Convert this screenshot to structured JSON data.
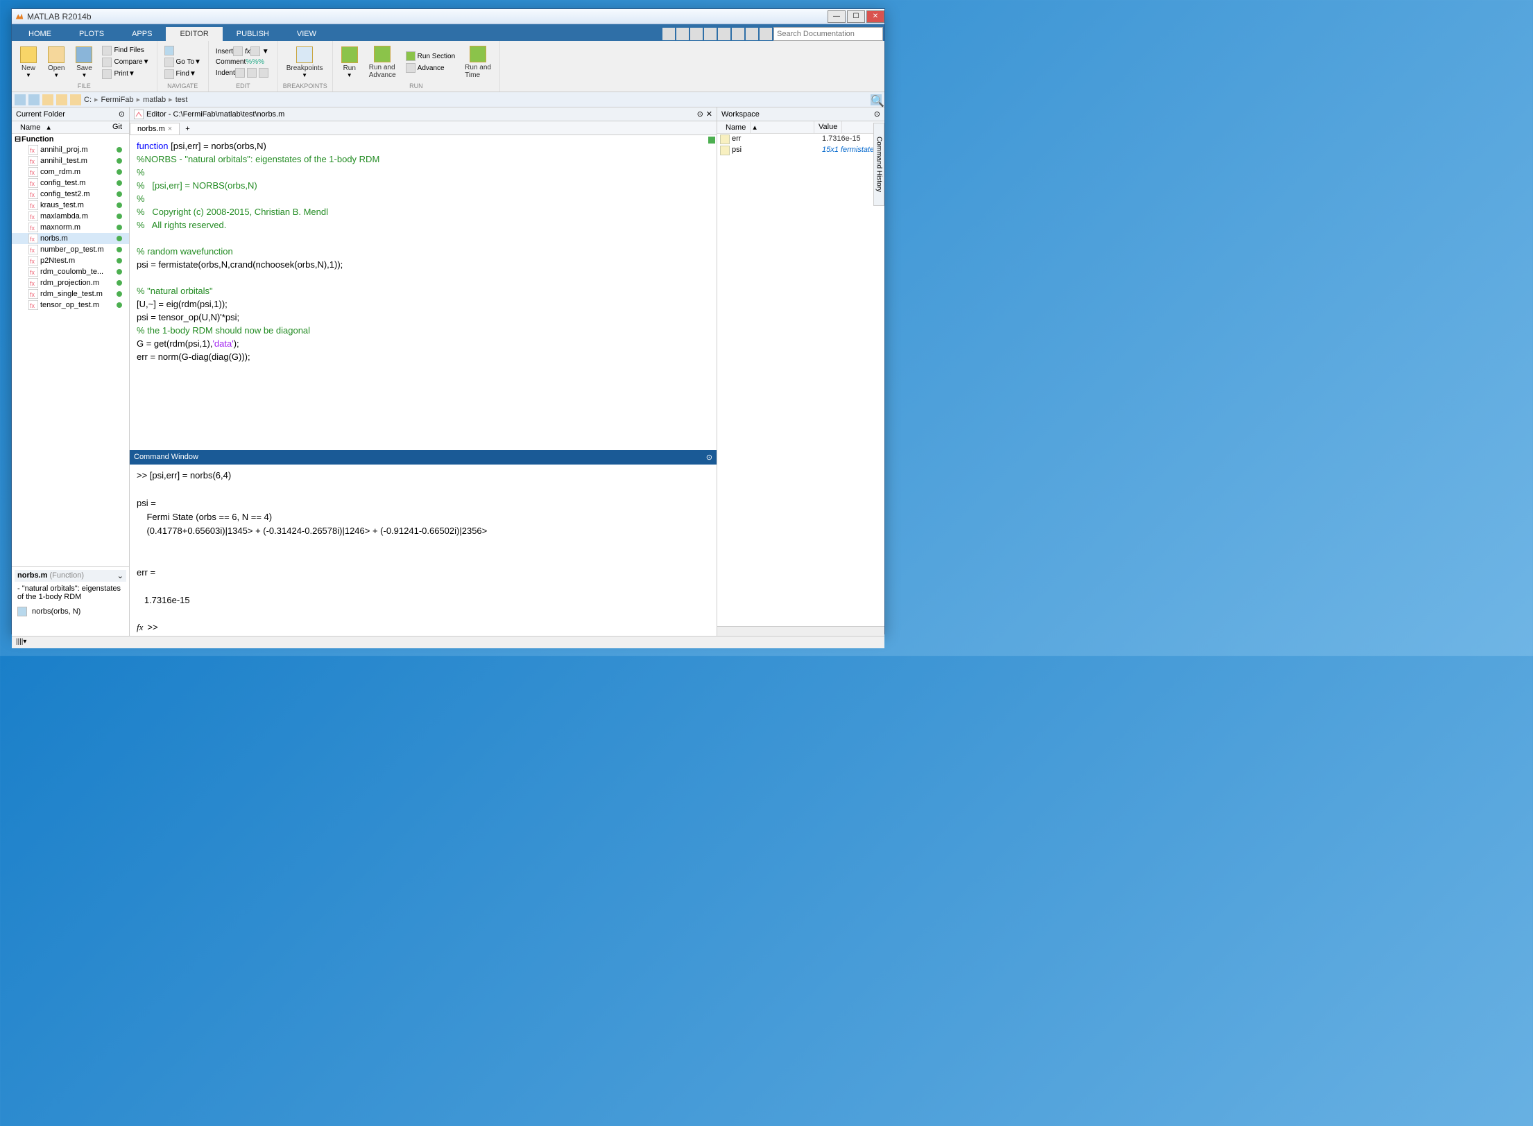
{
  "titlebar": {
    "title": "MATLAB R2014b"
  },
  "main_tabs": [
    "HOME",
    "PLOTS",
    "APPS",
    "EDITOR",
    "PUBLISH",
    "VIEW"
  ],
  "active_main_tab": "EDITOR",
  "ribbon": {
    "file": {
      "label": "FILE",
      "new": "New",
      "open": "Open",
      "save": "Save",
      "find_files": "Find Files",
      "compare": "Compare",
      "print": "Print"
    },
    "navigate": {
      "label": "NAVIGATE",
      "goto": "Go To",
      "find": "Find"
    },
    "edit": {
      "label": "EDIT",
      "insert": "Insert",
      "comment": "Comment",
      "indent": "Indent"
    },
    "breakpoints": {
      "label": "BREAKPOINTS",
      "btn": "Breakpoints"
    },
    "run": {
      "label": "RUN",
      "run": "Run",
      "run_advance": "Run and\nAdvance",
      "run_section": "Run Section",
      "advance": "Advance",
      "run_time": "Run and\nTime"
    }
  },
  "search_placeholder": "Search Documentation",
  "breadcrumb": [
    "C:",
    "FermiFab",
    "matlab",
    "test"
  ],
  "current_folder": {
    "title": "Current Folder",
    "cols": {
      "name": "Name",
      "git": "Git"
    },
    "folder": "Function",
    "files": [
      "annihil_proj.m",
      "annihil_test.m",
      "com_rdm.m",
      "config_test.m",
      "config_test2.m",
      "kraus_test.m",
      "maxlambda.m",
      "maxnorm.m",
      "norbs.m",
      "number_op_test.m",
      "p2Ntest.m",
      "rdm_coulomb_te...",
      "rdm_projection.m",
      "rdm_single_test.m",
      "tensor_op_test.m"
    ],
    "selected": "norbs.m"
  },
  "details": {
    "header": "norbs.m (Function)",
    "desc": "- \"natural orbitals\": eigenstates of the 1-body RDM",
    "sig": "norbs(orbs, N)"
  },
  "editor": {
    "header": "Editor - C:\\FermiFab\\matlab\\test\\norbs.m",
    "tab": "norbs.m",
    "code": {
      "l1_kw": "function",
      "l1_rest": " [psi,err] = norbs(orbs,N)",
      "l2": "%NORBS - \"natural orbitals\": eigenstates of the 1-body RDM",
      "l3": "%",
      "l4": "%   [psi,err] = NORBS(orbs,N)",
      "l5": "%",
      "l6": "%   Copyright (c) 2008-2015, Christian B. Mendl",
      "l7": "%   All rights reserved.",
      "l9": "% random wavefunction",
      "l10": "psi = fermistate(orbs,N,crand(nchoosek(orbs,N),1));",
      "l12": "% \"natural orbitals\"",
      "l13": "[U,~] = eig(rdm(psi,1));",
      "l14": "psi = tensor_op(U,N)'*psi;",
      "l15": "% the 1-body RDM should now be diagonal",
      "l16a": "G = get(rdm(psi,1),",
      "l16s": "'data'",
      "l16b": ");",
      "l17": "err = norm(G-diag(diag(G)));"
    }
  },
  "command_window": {
    "title": "Command Window",
    "output": ">> [psi,err] = norbs(6,4)\n\npsi = \n    Fermi State (orbs == 6, N == 4)\n    (0.41778+0.65603i)|1345> + (-0.31424-0.26578i)|1246> + (-0.91241-0.66502i)|2356>\n\n\nerr =\n\n   1.7316e-15",
    "prompt": ">> "
  },
  "workspace": {
    "title": "Workspace",
    "cols": {
      "name": "Name",
      "value": "Value"
    },
    "vars": [
      {
        "name": "err",
        "value": "1.7316e-15",
        "link": false
      },
      {
        "name": "psi",
        "value": "15x1 fermistate",
        "link": true
      }
    ]
  },
  "history_tab": "Command History",
  "statusbar": ""
}
